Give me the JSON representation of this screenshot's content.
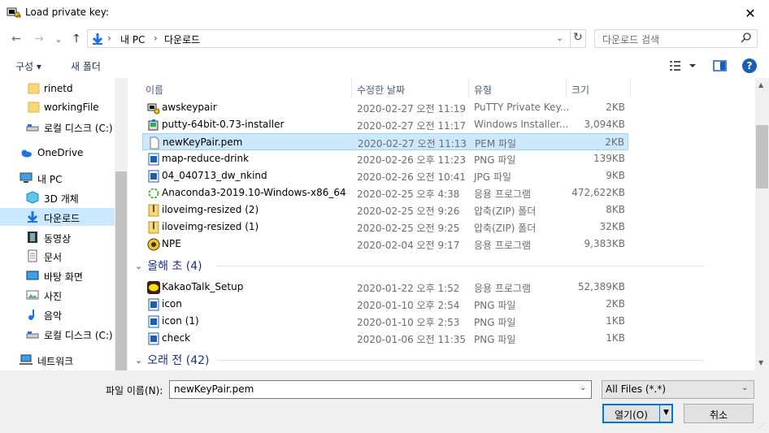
{
  "window": {
    "title": "Load private key:",
    "close_glyph": "✕"
  },
  "nav": {
    "back_glyph": "←",
    "forward_glyph": "→",
    "recent_glyph": "⌄",
    "up_glyph": "↑",
    "breadcrumbs": [
      "내 PC",
      "다운로드"
    ],
    "crumb_separator": "›",
    "search_placeholder": "다운로드 검색"
  },
  "toolbar": {
    "organize_label": "구성 ▾",
    "new_folder_label": "새 폴더"
  },
  "sidebar": [
    {
      "label": "rinetd",
      "icon": "folder-icon"
    },
    {
      "label": "workingFile",
      "icon": "folder-icon"
    },
    {
      "label": "로컬 디스크 (C:)",
      "icon": "drive-icon"
    },
    {
      "label": "OneDrive",
      "icon": "cloud-icon"
    },
    {
      "label": "내 PC",
      "icon": "computer-icon"
    },
    {
      "label": "3D 개체",
      "icon": "cube-icon"
    },
    {
      "label": "다운로드",
      "icon": "download-icon",
      "selected": true
    },
    {
      "label": "동영상",
      "icon": "video-icon"
    },
    {
      "label": "문서",
      "icon": "document-icon"
    },
    {
      "label": "바탕 화면",
      "icon": "desktop-icon"
    },
    {
      "label": "사진",
      "icon": "picture-icon"
    },
    {
      "label": "음악",
      "icon": "music-icon"
    },
    {
      "label": "로컬 디스크 (C:)",
      "icon": "drive-icon"
    },
    {
      "label": "네트워크",
      "icon": "network-icon"
    }
  ],
  "columns": {
    "name": "이름",
    "date": "수정한 날짜",
    "type": "유형",
    "size": "크기"
  },
  "files_recent": [
    {
      "name": "awskeypair",
      "date": "2020-02-27 오전 11:19",
      "type": "PuTTY Private Key...",
      "size": "2KB",
      "icon": "putty-key-icon"
    },
    {
      "name": "putty-64bit-0.73-installer",
      "date": "2020-02-27 오전 11:17",
      "type": "Windows Installer...",
      "size": "3,094KB",
      "icon": "installer-icon"
    },
    {
      "name": "newKeyPair.pem",
      "date": "2020-02-27 오전 11:13",
      "type": "PEM 파일",
      "size": "2KB",
      "icon": "blank-file-icon",
      "selected": true
    },
    {
      "name": "map-reduce-drink",
      "date": "2020-02-26 오후 11:23",
      "type": "PNG 파일",
      "size": "139KB",
      "icon": "image-file-icon"
    },
    {
      "name": "04_040713_dw_nkind",
      "date": "2020-02-26 오전 10:41",
      "type": "JPG 파일",
      "size": "9KB",
      "icon": "image-file-icon"
    },
    {
      "name": "Anaconda3-2019.10-Windows-x86_64",
      "date": "2020-02-25 오후 4:38",
      "type": "응용 프로그램",
      "size": "472,622KB",
      "icon": "anaconda-icon"
    },
    {
      "name": "iloveimg-resized (2)",
      "date": "2020-02-25 오전 9:26",
      "type": "압축(ZIP) 폴더",
      "size": "8KB",
      "icon": "zip-icon"
    },
    {
      "name": "iloveimg-resized (1)",
      "date": "2020-02-25 오전 9:25",
      "type": "압축(ZIP) 폴더",
      "size": "32KB",
      "icon": "zip-icon"
    },
    {
      "name": "NPE",
      "date": "2020-02-04 오전 9:17",
      "type": "응용 프로그램",
      "size": "9,383KB",
      "icon": "npe-icon"
    }
  ],
  "group_this_year": {
    "label": "올해 초 (4)",
    "chevron": "⌄"
  },
  "files_this_year": [
    {
      "name": "KakaoTalk_Setup",
      "date": "2020-01-22 오후 1:52",
      "type": "응용 프로그램",
      "size": "52,389KB",
      "icon": "kakaotalk-icon"
    },
    {
      "name": "icon",
      "date": "2020-01-10 오후 2:54",
      "type": "PNG 파일",
      "size": "2KB",
      "icon": "image-file-icon"
    },
    {
      "name": "icon (1)",
      "date": "2020-01-10 오후 2:53",
      "type": "PNG 파일",
      "size": "1KB",
      "icon": "image-file-icon"
    },
    {
      "name": "check",
      "date": "2020-01-06 오전 11:35",
      "type": "PNG 파일",
      "size": "1KB",
      "icon": "image-file-icon"
    }
  ],
  "group_long_ago": {
    "label": "오래 전 (42)",
    "chevron": "⌄"
  },
  "footer": {
    "filename_label": "파일 이름(N):",
    "filename_value": "newKeyPair.pem",
    "filter_value": "All Files (*.*)",
    "open_label": "열기(O)",
    "cancel_label": "취소"
  },
  "colors": {
    "selection": "#cce8ff",
    "accent": "#0078d7"
  }
}
